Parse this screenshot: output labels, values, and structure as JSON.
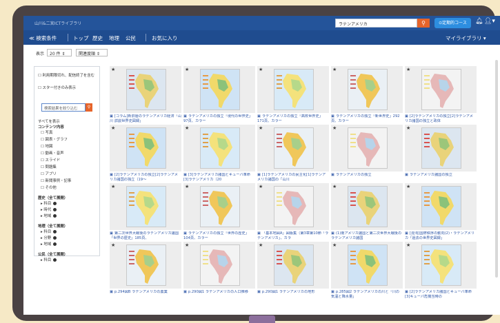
{
  "topbar": {
    "app_title": "山川&二宮ICTライブラリ",
    "search_value": "ラテンアメリカ",
    "course_label": "⊙定期的コース",
    "bell_icon": "bell-icon",
    "user_icon": "user-icon"
  },
  "nav": {
    "search_conditions": "≪ 検索条件",
    "top": "トップ",
    "history": "歴史",
    "geography": "地理",
    "civics": "公民",
    "favorites": "お気に入り",
    "my_library": "マイライブラリ ▾"
  },
  "toolbar": {
    "display_label": "表示",
    "count_value": "20 件",
    "sort_value": "関連度順"
  },
  "sidebar": {
    "expired_checkbox": "利用期限切れ、配信終了を含む",
    "starred_checkbox": "スター付きのみ表示",
    "filter_placeholder": "検索結果を絞り込む",
    "show_all": "すべてを表示",
    "content_header": "コンテンツ内容",
    "content_types": [
      "写真",
      "図表・グラフ",
      "地図",
      "動画・音声",
      "スライド",
      "問題集",
      "アプリ",
      "新聞事例・記事",
      "その他"
    ],
    "history_header": "歴史（全て展開）",
    "history_items": [
      "科目",
      "時代",
      "地域"
    ],
    "geo_header": "地理（全て展開）",
    "geo_items": [
      "科目",
      "分野",
      "地域"
    ],
    "civics_header": "公民（全て展開）",
    "civics_items": [
      "科目"
    ]
  },
  "cards": [
    [
      "[コラム]新旧暦のラテンアメリカ経済「山川 詳説世界史図録」",
      "ラテンアメリカの独立「現代の世界史」97頁、カラー",
      "ラテンアメリカの独立「高校世界史」171頁、カラー",
      "ラテンアメリカの独立「新世界史」292頁、カラー",
      "[2]ラテンアメリカの独立[2]ラテンアメリカ諸国の独立と政体"
    ],
    [
      "[2]ラテンアメリカの独立[2]ラテンアメリカ諸国の独立（19～",
      "[3]ラテンアメリカ諸国とキューバ革命[3]ラテンアメリカ（20",
      "[1]ラテンアメリカの民主化[1]ラテンアメリカ諸国の「山川",
      "ラテンアメリカの独立",
      "ラテンアメリカ諸国の独立"
    ],
    [
      "第二次世界大戦後のラテンアメリカ諸国「世界の歴史」185頁、",
      "ラテンアメリカの独立「世界の歴史」104頁、カラー",
      "「基本地図A」図版集（第3章第10節「ラテンアメリカ」、カラ",
      "(1)南アメリカ諸国と第二次世界大戦後のラテンアメリカ諸国",
      "[混沌]国際秩序の動向(2)・ラテンアメリカ「過去の世界史図録」"
    ],
    [
      "p.294図B ラテンアメリカの農業",
      "p.290図1 ラテンアメリカの人口推移",
      "p.290図1 ラテンアメリカの地形",
      "p.285図2 ラテンアメリカの川と「川の気温と降水量」",
      "[2]ラテンアメリカ諸国とキューバ革命[3]キューバ危機当時の"
    ]
  ]
}
